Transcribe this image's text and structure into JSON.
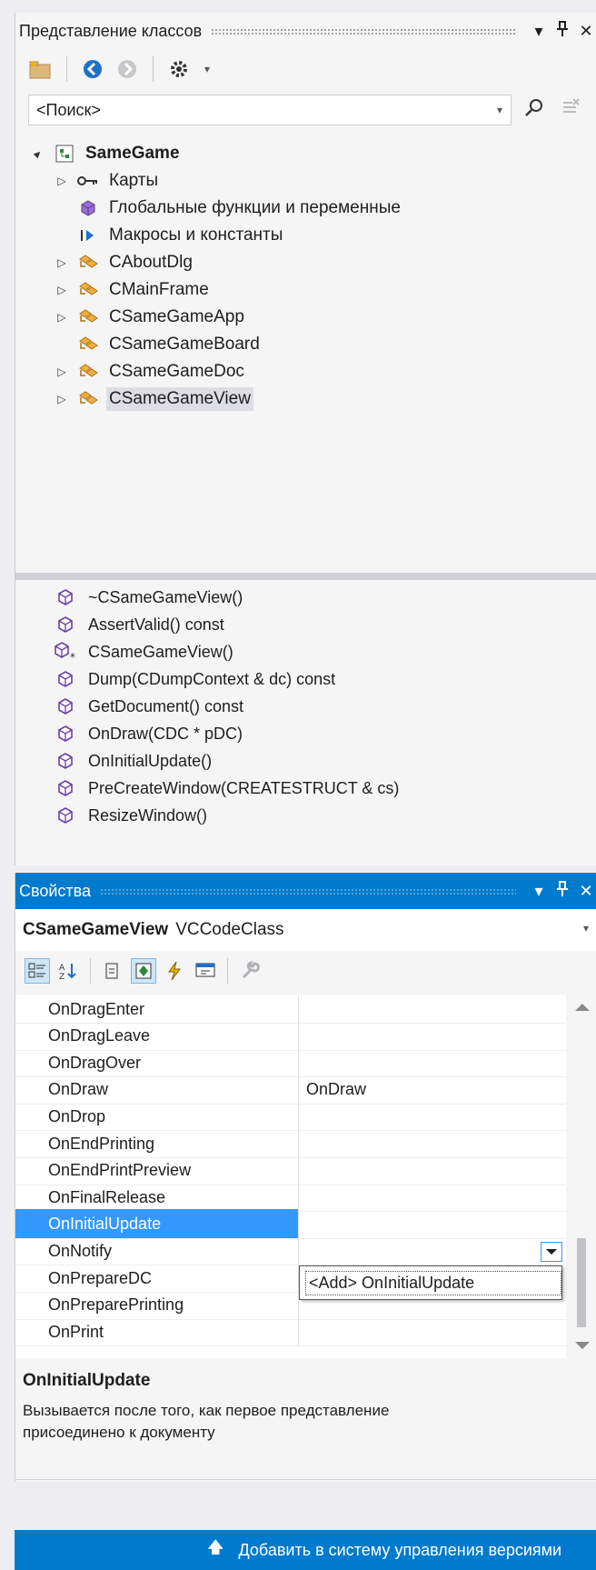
{
  "class_view": {
    "title": "Представление классов",
    "pin_icon": "pin-icon",
    "search": {
      "value": "<Поиск>"
    },
    "tree": [
      {
        "label": "SameGame",
        "icon": "project-icon",
        "expander": "▲",
        "bold": true
      },
      {
        "label": "Карты",
        "icon": "key-icon",
        "expander": "▷"
      },
      {
        "label": "Глобальные функции и переменные",
        "icon": "globals-icon",
        "expander": ""
      },
      {
        "label": "Макросы и константы",
        "icon": "macro-icon",
        "expander": ""
      },
      {
        "label": "CAboutDlg",
        "icon": "class-icon",
        "expander": "▷"
      },
      {
        "label": "CMainFrame",
        "icon": "class-icon",
        "expander": "▷"
      },
      {
        "label": "CSameGameApp",
        "icon": "class-icon",
        "expander": "▷"
      },
      {
        "label": "CSameGameBoard",
        "icon": "class-icon",
        "expander": ""
      },
      {
        "label": "CSameGameDoc",
        "icon": "class-icon",
        "expander": "▷"
      },
      {
        "label": "CSameGameView",
        "icon": "class-icon",
        "expander": "▷",
        "selected": true
      }
    ],
    "members": [
      "~CSameGameView()",
      "AssertValid() const",
      "CSameGameView()",
      "Dump(CDumpContext & dc) const",
      "GetDocument() const",
      "OnDraw(CDC * pDC)",
      "OnInitialUpdate()",
      "PreCreateWindow(CREATESTRUCT & cs)",
      "ResizeWindow()"
    ]
  },
  "properties": {
    "title": "Свойства",
    "object_name": "CSameGameView",
    "object_type": "VCCodeClass",
    "rows": [
      {
        "name": "OnDragEnter",
        "value": ""
      },
      {
        "name": "OnDragLeave",
        "value": ""
      },
      {
        "name": "OnDragOver",
        "value": ""
      },
      {
        "name": "OnDraw",
        "value": "OnDraw"
      },
      {
        "name": "OnDrop",
        "value": ""
      },
      {
        "name": "OnEndPrinting",
        "value": ""
      },
      {
        "name": "OnEndPrintPreview",
        "value": ""
      },
      {
        "name": "OnFinalRelease",
        "value": ""
      },
      {
        "name": "OnInitialUpdate",
        "value": "",
        "selected": true
      },
      {
        "name": "OnNotify",
        "value": ""
      },
      {
        "name": "OnPrepareDC",
        "value": ""
      },
      {
        "name": "OnPreparePrinting",
        "value": ""
      },
      {
        "name": "OnPrint",
        "value": ""
      }
    ],
    "dropdown_option": "<Add> OnInitialUpdate",
    "description_title": "OnInitialUpdate",
    "description_text": "Вызывается после того, как первое представление присоединено к документу"
  },
  "status_bar": {
    "text": "Добавить в систему управления версиями"
  },
  "colors": {
    "accent": "#007acc",
    "selection": "#3399ff",
    "class_icon": "#d9901a"
  }
}
